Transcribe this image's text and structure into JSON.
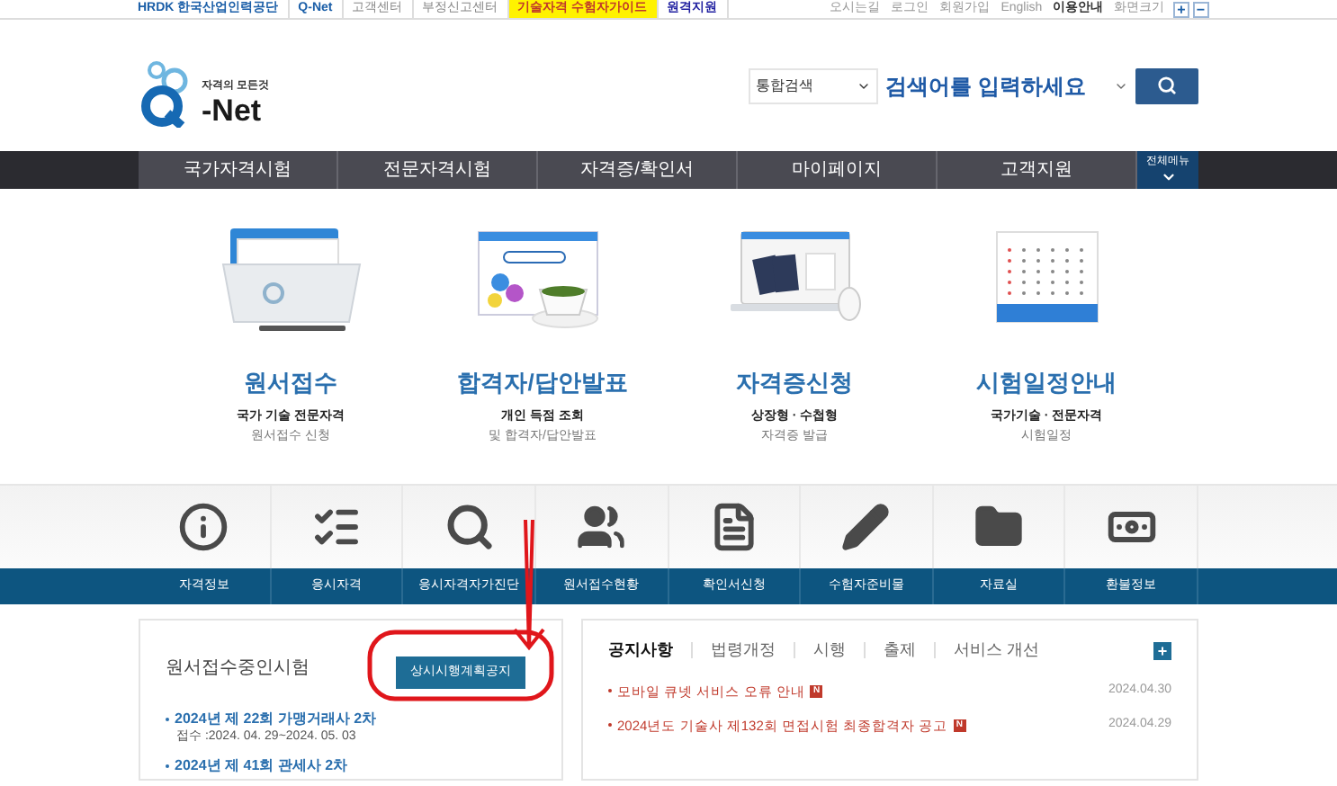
{
  "top_bar": {
    "left_links": [
      {
        "label": "HRDK 한국산업인력공단",
        "kind": "logo"
      },
      {
        "label": "Q-Net",
        "kind": "logo"
      },
      {
        "label": "고객센터",
        "kind": "link"
      },
      {
        "label": "부정신고센터",
        "kind": "link"
      },
      {
        "label": "기술자격 수험자가이드",
        "kind": "highlight"
      },
      {
        "label": "원격지원",
        "kind": "strong"
      }
    ],
    "right_links": [
      {
        "label": "오시는길",
        "bold": false
      },
      {
        "label": "로그인",
        "bold": false
      },
      {
        "label": "회원가입",
        "bold": false
      },
      {
        "label": "English",
        "bold": false
      },
      {
        "label": "이용안내",
        "bold": true
      },
      {
        "label": "화면크기",
        "bold": false
      }
    ],
    "zoom_buttons": [
      "+",
      "−"
    ]
  },
  "header": {
    "logo": {
      "tagline": "자격의 모든것",
      "name": "-Net"
    },
    "search": {
      "scope": "통합검색",
      "placeholder": "검색어를 입력하세요"
    }
  },
  "main_nav": {
    "items": [
      "국가자격시험",
      "전문자격시험",
      "자격증/확인서",
      "마이페이지",
      "고객지원"
    ],
    "all_menu": "전체메뉴"
  },
  "quick_cards": [
    {
      "kind": "folder",
      "title": "원서접수",
      "line1": "국가 기술 전문자격",
      "line2": "원서접수 신청"
    },
    {
      "kind": "browser",
      "title": "합격자/답안발표",
      "line1": "개인 득점 조회",
      "line2": "및 합격자/답안발표"
    },
    {
      "kind": "laptop",
      "title": "자격증신청",
      "line1": "상장형 · 수첩형",
      "line2": "자격증 발급"
    },
    {
      "kind": "calendar",
      "title": "시험일정안내",
      "line1": "국가기술 · 전문자격",
      "line2": "시험일정"
    }
  ],
  "shortcuts": [
    {
      "kind": "info",
      "label": "자격정보"
    },
    {
      "kind": "list",
      "label": "응시자격"
    },
    {
      "kind": "search",
      "label": "응시자격자가진단"
    },
    {
      "kind": "people",
      "label": "원서접수현황"
    },
    {
      "kind": "document",
      "label": "확인서신청"
    },
    {
      "kind": "pencil",
      "label": "수험자준비물"
    },
    {
      "kind": "folder",
      "label": "자료실"
    },
    {
      "kind": "money",
      "label": "환불정보"
    }
  ],
  "exam_panel": {
    "title": "원서접수중인시험",
    "button": "상시시행계획공지",
    "items": [
      {
        "name": "2024년 제 22회 가맹거래사 2차",
        "period": "접수 :2024. 04. 29~2024. 05. 03"
      },
      {
        "name": "2024년 제 41회 관세사 2차"
      }
    ]
  },
  "notice_panel": {
    "tabs": [
      {
        "label": "공지사항",
        "selected": true
      },
      {
        "label": "법령개정",
        "selected": false
      },
      {
        "label": "시행",
        "selected": false
      },
      {
        "label": "출제",
        "selected": false
      },
      {
        "label": "서비스 개선",
        "selected": false
      }
    ],
    "more": "+",
    "items": [
      {
        "title": "모바일 큐넷 서비스 오류 안내",
        "new": true,
        "badge": "N",
        "date": "2024.04.30"
      },
      {
        "title": "2024년도 기술사 제132회 면접시험 최종합격자 공고",
        "new": true,
        "badge": "N",
        "date": "2024.04.29"
      }
    ]
  }
}
